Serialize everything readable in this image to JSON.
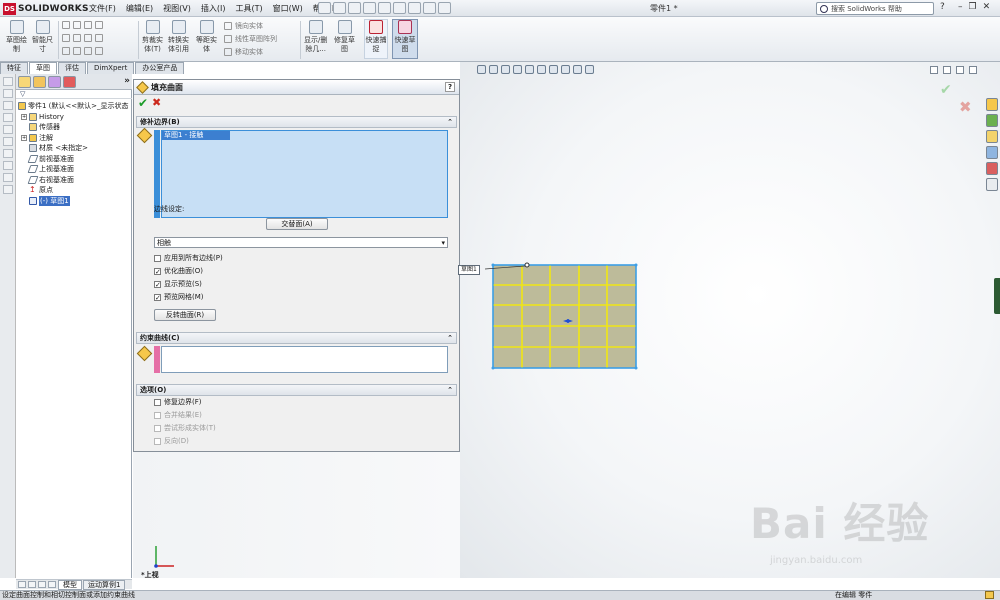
{
  "app": {
    "logo_text": "SOLIDWORKS",
    "document_title": "零件1 *",
    "search_placeholder": "搜索 SolidWorks 帮助",
    "menus": [
      "文件(F)",
      "编辑(E)",
      "视图(V)",
      "插入(I)",
      "工具(T)",
      "窗口(W)",
      "帮助(H)"
    ],
    "help_icon": "question-icon"
  },
  "command_manager": {
    "buttons": [
      {
        "label": "草图绘\n制",
        "icon": "sketch-icon"
      },
      {
        "label": "智能尺\n寸",
        "icon": "smart-dimension-icon"
      },
      {
        "label": "剪裁实\n体(T)",
        "icon": "trim-icon"
      },
      {
        "label": "转换实\n体引用",
        "icon": "convert-entities-icon"
      },
      {
        "label": "等距实\n体",
        "icon": "offset-entities-icon"
      },
      {
        "label": "显示/删\n除几...",
        "icon": "relations-icon"
      },
      {
        "label": "修复草\n图",
        "icon": "repair-sketch-icon"
      },
      {
        "label": "快速捕\n捉",
        "icon": "quick-snap-icon"
      },
      {
        "label": "快速草\n图",
        "icon": "rapid-sketch-icon"
      }
    ],
    "small_rows": [
      "镜向实体",
      "线性草图阵列",
      "移动实体"
    ],
    "tabs": [
      "特征",
      "草图",
      "评估",
      "DimXpert",
      "办公室产品"
    ],
    "active_tab": "草图"
  },
  "feature_tree": {
    "filter_icon": "filter-icon",
    "root": "零件1 (默认<<默认>_显示状态",
    "items": [
      {
        "label": "History",
        "icon": "history-icon",
        "expand": "+"
      },
      {
        "label": "传感器",
        "icon": "sensor-icon",
        "expand": ""
      },
      {
        "label": "注解",
        "icon": "annotation-icon",
        "expand": "+"
      },
      {
        "label": "材质 <未指定>",
        "icon": "material-icon",
        "expand": ""
      },
      {
        "label": "前视基准面",
        "icon": "plane-icon",
        "expand": ""
      },
      {
        "label": "上视基准面",
        "icon": "plane-icon",
        "expand": ""
      },
      {
        "label": "右视基准面",
        "icon": "plane-icon",
        "expand": ""
      },
      {
        "label": "原点",
        "icon": "origin-icon",
        "expand": ""
      },
      {
        "label": "(-) 草图1",
        "icon": "sketch-icon",
        "expand": "",
        "selected": true
      }
    ],
    "bottom_tabs": [
      "模型",
      "运动算例1"
    ]
  },
  "property_manager": {
    "title": "填充曲面",
    "help": "?",
    "patch_boundary": {
      "header": "修补边界(B)",
      "list_items": [
        "草图1 - 接触"
      ],
      "edge_settings_label": "边线设定:",
      "alternate_face_button": "交替面(A)",
      "contact_select": "相触",
      "checkboxes": [
        {
          "label": "应用到所有边线(P)",
          "checked": false
        },
        {
          "label": "优化曲面(O)",
          "checked": true
        },
        {
          "label": "显示预览(S)",
          "checked": true
        },
        {
          "label": "预览网格(M)",
          "checked": true
        }
      ],
      "reverse_button": "反转曲面(R)"
    },
    "constraint_curves": {
      "header": "约束曲线(C)"
    },
    "options": {
      "header": "选项(O)",
      "checkboxes": [
        {
          "label": "修复边界(F)",
          "checked": false,
          "disabled": false
        },
        {
          "label": "合并结果(E)",
          "checked": false,
          "disabled": true
        },
        {
          "label": "尝试形成实体(T)",
          "checked": false,
          "disabled": true
        },
        {
          "label": "反向(D)",
          "checked": false,
          "disabled": true
        }
      ]
    }
  },
  "graphics": {
    "callout_label": "草图1",
    "view_name": "*上视",
    "grid_fill_color": "#bdbb9a",
    "grid_line_color": "#f0e614",
    "border_color": "#3d9fe6",
    "watermark_main": "Bai 经验",
    "watermark_sub": "jingyan.baidu.com"
  },
  "status_bar": {
    "message": "设定曲面控制和相切控制面或添加约束曲线",
    "right_1": "在编辑 零件"
  }
}
